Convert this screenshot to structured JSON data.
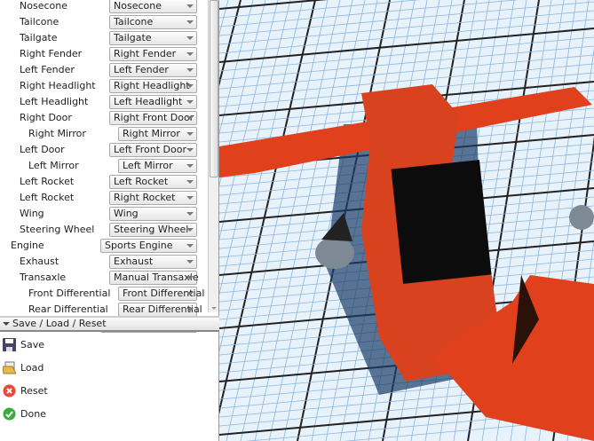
{
  "parts": [
    {
      "label": "Nosecone",
      "value": "Nosecone",
      "level": 1
    },
    {
      "label": "Tailcone",
      "value": "Tailcone",
      "level": 1
    },
    {
      "label": "Tailgate",
      "value": "Tailgate",
      "level": 1
    },
    {
      "label": "Right Fender",
      "value": "Right Fender",
      "level": 1
    },
    {
      "label": "Left Fender",
      "value": "Left Fender",
      "level": 1
    },
    {
      "label": "Right Headlight",
      "value": "Right Headlight",
      "level": 1
    },
    {
      "label": "Left Headlight",
      "value": "Left Headlight",
      "level": 1
    },
    {
      "label": "Right Door",
      "value": "Right Front Door",
      "level": 1
    },
    {
      "label": "Right Mirror",
      "value": "Right Mirror",
      "level": 2
    },
    {
      "label": "Left Door",
      "value": "Left Front Door",
      "level": 1
    },
    {
      "label": "Left Mirror",
      "value": "Left Mirror",
      "level": 2
    },
    {
      "label": "Left Rocket",
      "value": "Left Rocket",
      "level": 1
    },
    {
      "label": "Left Rocket",
      "value": "Right Rocket",
      "level": 1
    },
    {
      "label": "Wing",
      "value": "Wing",
      "level": 1
    },
    {
      "label": "Steering Wheel",
      "value": "Steering Wheel",
      "level": 1
    },
    {
      "label": "Engine",
      "value": "Sports Engine",
      "level": 0
    },
    {
      "label": "Exhaust",
      "value": "Exhaust",
      "level": 1
    },
    {
      "label": "Transaxle",
      "value": "Manual Transaxle",
      "level": 1
    },
    {
      "label": "Front Differential",
      "value": "Front Differential",
      "level": 2
    },
    {
      "label": "Rear Differential",
      "value": "Rear Differential",
      "level": 2
    },
    {
      "label": "",
      "value": "",
      "level": 0
    }
  ],
  "section": {
    "title": "Save / Load / Reset"
  },
  "actions": [
    {
      "label": "Save",
      "icon": "floppy-disk-icon"
    },
    {
      "label": "Load",
      "icon": "folder-icon"
    },
    {
      "label": "Reset",
      "icon": "reset-x-icon"
    },
    {
      "label": "Done",
      "icon": "checkmark-icon"
    }
  ],
  "colors": {
    "car": "#e0401c",
    "floor": "#e8f2fb",
    "grid": "#222222"
  }
}
